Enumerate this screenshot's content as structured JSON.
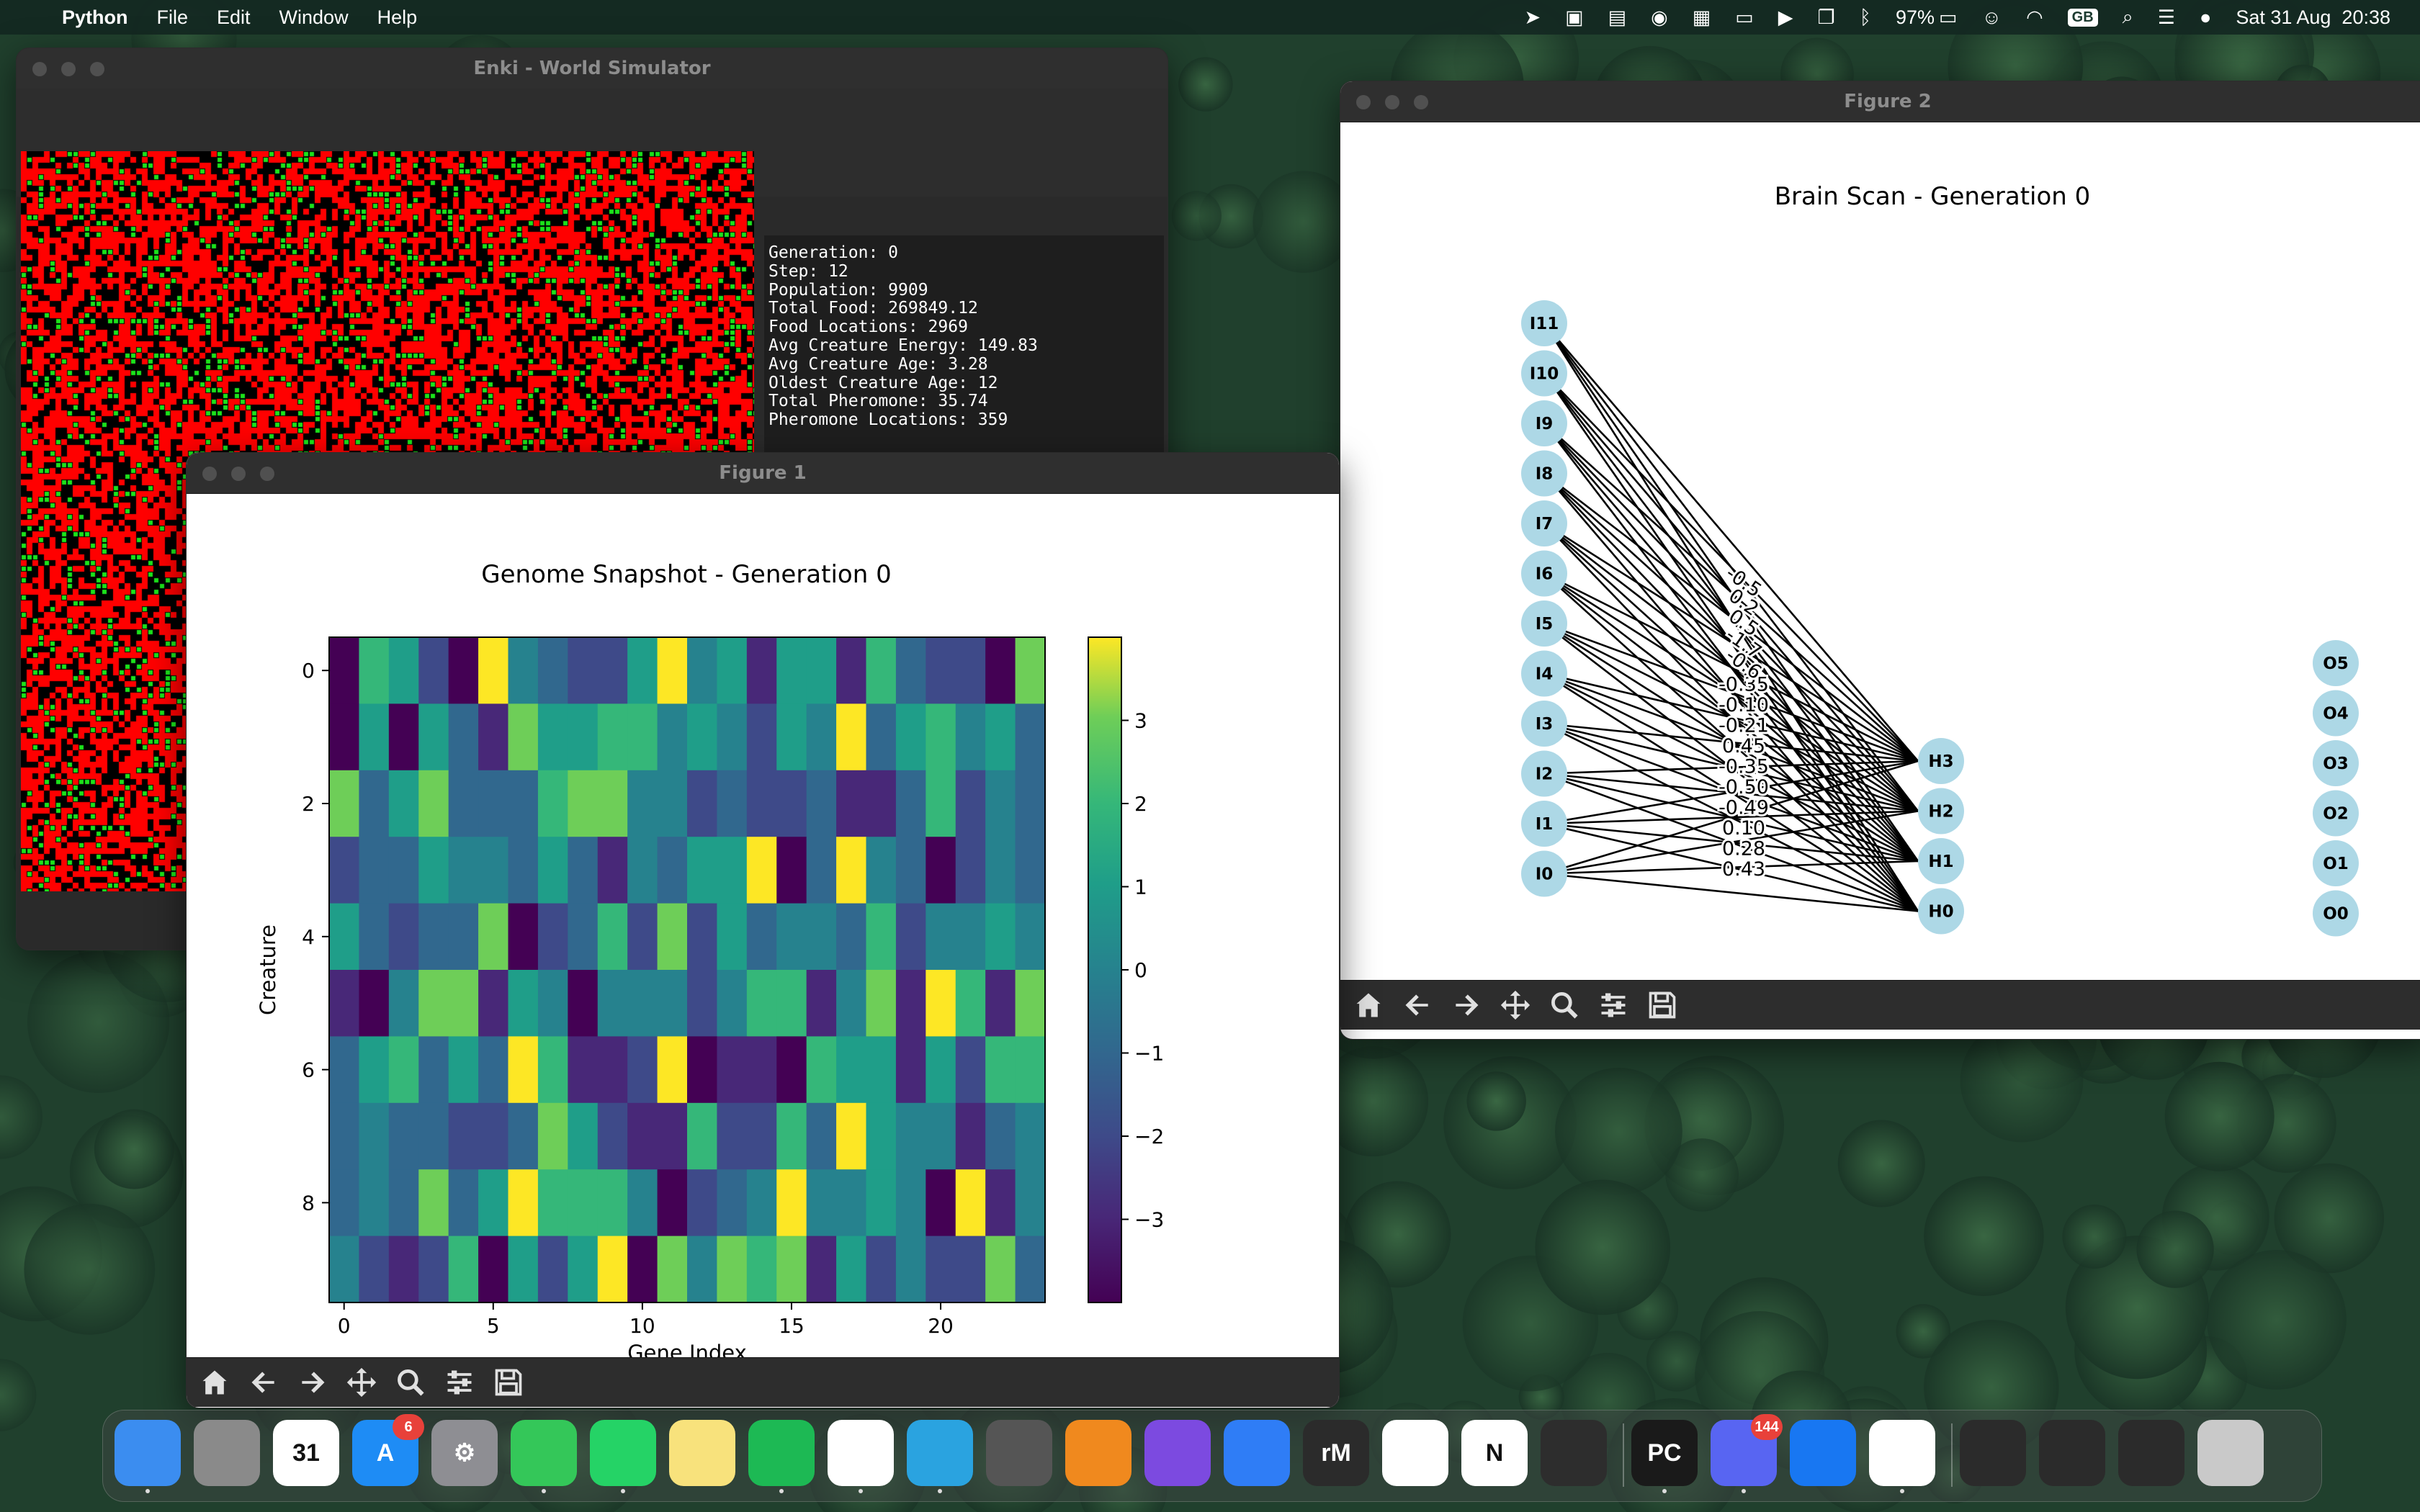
{
  "menubar": {
    "app_name": "Python",
    "menus": [
      "File",
      "Edit",
      "Window",
      "Help"
    ],
    "battery": "97%",
    "keyboard_layout": "GB",
    "datetime": "Sat 31 Aug  20:38",
    "status_icons": [
      "telegram-icon",
      "calendar-icon",
      "stage-manager-icon",
      "vpn-icon",
      "calendar-31-icon",
      "window-icon",
      "play-icon",
      "screen-mirroring-icon",
      "bluetooth-icon",
      "battery-icon",
      "user-icon",
      "wifi-icon",
      "spotlight-icon",
      "control-center-icon",
      "siri-icon"
    ]
  },
  "enki": {
    "title": "Enki - World Simulator",
    "stats": [
      "Generation: 0",
      "Step: 12",
      "Population: 9909",
      "Total Food: 269849.12",
      "Food Locations: 2969",
      "Avg Creature Energy: 149.83",
      "Avg Creature Age: 3.28",
      "Oldest Creature Age: 12",
      "Total Pheromone: 35.74",
      "Pheromone Locations: 359"
    ],
    "grid_colors": {
      "creature": "#ff0000",
      "food": "#1be31b",
      "empty": "#000000"
    }
  },
  "fig1": {
    "title": "Figure 1",
    "toolbar": [
      "home-icon",
      "back-icon",
      "forward-icon",
      "pan-icon",
      "zoom-icon",
      "configure-icon",
      "save-icon"
    ]
  },
  "fig2": {
    "title": "Figure 2",
    "toolbar": [
      "home-icon",
      "back-icon",
      "forward-icon",
      "pan-icon",
      "zoom-icon",
      "configure-icon",
      "save-icon"
    ]
  },
  "chart_data": [
    {
      "type": "heatmap",
      "title": "Genome Snapshot - Generation 0",
      "xlabel": "Gene Index",
      "ylabel": "Creature",
      "x_ticks": [
        0,
        5,
        10,
        15,
        20
      ],
      "y_ticks": [
        0,
        2,
        4,
        6,
        8
      ],
      "colorbar_ticks": [
        3,
        2,
        1,
        0,
        -1,
        -2,
        -3
      ],
      "colorbar_tick_labels": [
        "3",
        "2",
        "1",
        "0",
        "−1",
        "−2",
        "−3"
      ],
      "vmin": -4,
      "vmax": 4,
      "colormap": "viridis",
      "rows": 10,
      "cols": 24,
      "values": [
        [
          -4,
          2,
          1,
          -2,
          -4,
          4,
          0,
          -1,
          -2,
          -2,
          1,
          4,
          0,
          1,
          -3,
          1,
          1,
          -3,
          2,
          -1,
          -2,
          -2,
          -4,
          3
        ],
        [
          -4,
          1,
          -4,
          1,
          -1,
          -3,
          3,
          1,
          1,
          2,
          2,
          0,
          1,
          0,
          -2,
          1,
          0,
          4,
          -1,
          1,
          2,
          0,
          1,
          -1
        ],
        [
          3,
          -1,
          1,
          3,
          -1,
          -1,
          -1,
          2,
          3,
          3,
          0,
          0,
          -2,
          -1,
          -2,
          -2,
          -1,
          -3,
          -3,
          -1,
          2,
          -2,
          0,
          -1
        ],
        [
          -2,
          -1,
          -1,
          1,
          0,
          0,
          -1,
          1,
          -1,
          -3,
          0,
          -1,
          1,
          1,
          4,
          -4,
          -1,
          4,
          0,
          -1,
          -4,
          -2,
          0,
          -1
        ],
        [
          1,
          -1,
          -2,
          -1,
          -1,
          3,
          -4,
          -2,
          -1,
          2,
          -2,
          3,
          -2,
          1,
          -1,
          0,
          0,
          -1,
          2,
          -2,
          0,
          0,
          1,
          0
        ],
        [
          -3,
          -4,
          0,
          3,
          3,
          -3,
          1,
          0,
          -4,
          0,
          0,
          0,
          -2,
          0,
          2,
          2,
          -3,
          0,
          3,
          -3,
          4,
          2,
          -3,
          3
        ],
        [
          -1,
          1,
          2,
          -1,
          1,
          -1,
          4,
          2,
          -3,
          -3,
          -2,
          4,
          -4,
          -3,
          -3,
          -4,
          2,
          1,
          1,
          -3,
          1,
          -2,
          2,
          2
        ],
        [
          -1,
          0,
          -1,
          -1,
          -2,
          -2,
          -1,
          3,
          1,
          -2,
          -3,
          -3,
          2,
          -2,
          -2,
          2,
          -1,
          4,
          1,
          0,
          0,
          -3,
          -1,
          0
        ],
        [
          -1,
          0,
          -1,
          3,
          -1,
          1,
          4,
          2,
          2,
          2,
          0,
          -4,
          -2,
          -1,
          0,
          4,
          0,
          0,
          1,
          0,
          -4,
          4,
          -3,
          0
        ],
        [
          0,
          -2,
          -3,
          -2,
          2,
          -4,
          1,
          -2,
          1,
          4,
          -4,
          3,
          0,
          3,
          2,
          3,
          -3,
          1,
          -2,
          0,
          -2,
          -2,
          3,
          -1
        ]
      ]
    },
    {
      "type": "network",
      "title": "Brain Scan - Generation 0",
      "input_nodes": [
        "I11",
        "I10",
        "I9",
        "I8",
        "I7",
        "I6",
        "I5",
        "I4",
        "I3",
        "I2",
        "I1",
        "I0"
      ],
      "hidden_nodes": [
        "H3",
        "H2",
        "H1",
        "H0"
      ],
      "output_nodes": [
        "O5",
        "O4",
        "O3",
        "O2",
        "O1",
        "O0"
      ],
      "visible_edge_labels": [
        "0.43",
        "0.28",
        "0.10",
        "-0.49",
        "-0.50",
        "-0.35",
        "0.45",
        "-0.21",
        "-0.10",
        "-0.35",
        "-0.6",
        "-1.7",
        "0.5",
        "0.2",
        "-0.5"
      ],
      "node_color": "#add8e6"
    }
  ],
  "dock": {
    "apps": [
      {
        "name": "Finder",
        "icon": "finder-icon",
        "color": "#3b8df0",
        "label": "",
        "dot": true
      },
      {
        "name": "Launchpad",
        "icon": "launchpad-icon",
        "color": "#8a8a8a",
        "label": "",
        "dot": false
      },
      {
        "name": "Calendar",
        "icon": "calendar-icon",
        "color": "#ffffff",
        "label": "31",
        "dot": false
      },
      {
        "name": "App Store",
        "icon": "app-store-icon",
        "color": "#1e8cf5",
        "label": "A",
        "dot": false,
        "badge": "6"
      },
      {
        "name": "System Settings",
        "icon": "settings-icon",
        "color": "#8e8e93",
        "label": "⚙",
        "dot": false
      },
      {
        "name": "Messages",
        "icon": "messages-icon",
        "color": "#34c759",
        "label": "",
        "dot": true
      },
      {
        "name": "WhatsApp",
        "icon": "whatsapp-icon",
        "color": "#25d366",
        "label": "",
        "dot": true
      },
      {
        "name": "Notes",
        "icon": "notes-icon",
        "color": "#f8e27c",
        "label": "",
        "dot": false
      },
      {
        "name": "Spotify",
        "icon": "spotify-icon",
        "color": "#1db954",
        "label": "",
        "dot": true
      },
      {
        "name": "Chrome",
        "icon": "chrome-icon",
        "color": "#ffffff",
        "label": "",
        "dot": true
      },
      {
        "name": "Telegram",
        "icon": "telegram-icon",
        "color": "#2aa3e0",
        "label": "",
        "dot": true
      },
      {
        "name": "Calculator",
        "icon": "calculator-icon",
        "color": "#555555",
        "label": "",
        "dot": false
      },
      {
        "name": "VLC",
        "icon": "vlc-icon",
        "color": "#f0891e",
        "label": "",
        "dot": false
      },
      {
        "name": "GitHub Desktop",
        "icon": "github-icon",
        "color": "#7c4ae0",
        "label": "",
        "dot": false
      },
      {
        "name": "Pages",
        "icon": "pages-icon",
        "color": "#2f7df6",
        "label": "",
        "dot": false
      },
      {
        "name": "reMarkable",
        "icon": "remarkable-icon",
        "color": "#2b2b2b",
        "label": "rM",
        "dot": false
      },
      {
        "name": "Slack",
        "icon": "slack-icon",
        "color": "#ffffff",
        "label": "",
        "dot": false
      },
      {
        "name": "Notion",
        "icon": "notion-icon",
        "color": "#ffffff",
        "label": "N",
        "dot": false
      },
      {
        "name": "OBS",
        "icon": "obs-icon",
        "color": "#2d2d2d",
        "label": "",
        "dot": false
      },
      {
        "name": "PyCharm",
        "icon": "pycharm-icon",
        "color": "#1a1a1a",
        "label": "PC",
        "dot": true
      },
      {
        "name": "Discord",
        "icon": "discord-icon",
        "color": "#5865f2",
        "label": "",
        "dot": true,
        "badge": "144"
      },
      {
        "name": "Keynote",
        "icon": "keynote-icon",
        "color": "#1877f2",
        "label": "",
        "dot": false
      },
      {
        "name": "Python",
        "icon": "python-rocket-icon",
        "color": "#ffffff",
        "label": "",
        "dot": true
      },
      {
        "name": "Window 1",
        "icon": "window-thumb-icon",
        "color": "#2b2b2b",
        "label": "",
        "dot": false
      },
      {
        "name": "Window 2",
        "icon": "window-thumb-icon",
        "color": "#2b2b2b",
        "label": "",
        "dot": false
      },
      {
        "name": "Window 3",
        "icon": "window-thumb-icon",
        "color": "#2b2b2b",
        "label": "",
        "dot": false
      },
      {
        "name": "Trash",
        "icon": "trash-icon",
        "color": "#c9c9c9",
        "label": "",
        "dot": false
      }
    ]
  }
}
